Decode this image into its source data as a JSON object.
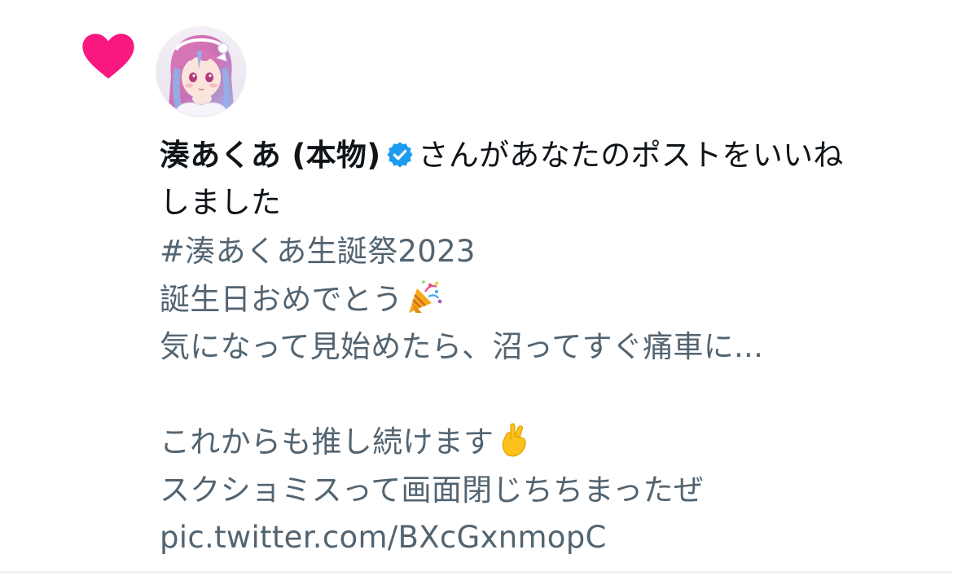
{
  "notification": {
    "type_icon": "heart-icon",
    "accent_color": "#f91880",
    "user": {
      "avatar": "avatar",
      "name": "湊あくあ (本物)",
      "verified_icon": "verified-badge-icon",
      "verified_color": "#1d9bf0"
    },
    "action_text": "さんがあなたのポストをいいね",
    "action_text_cont": "しました",
    "post_lines": [
      "#湊あくあ生誕祭2023",
      "誕生日おめでとう",
      "気になって見始めたら、沼ってすぐ痛車に...",
      "",
      "これからも推し続けます",
      "スクショミスって画面閉じちちまったぜ",
      "pic.twitter.com/BXcGxnmopC"
    ],
    "emojis": [
      "party-popper-icon",
      "crossed-fingers-icon"
    ]
  }
}
